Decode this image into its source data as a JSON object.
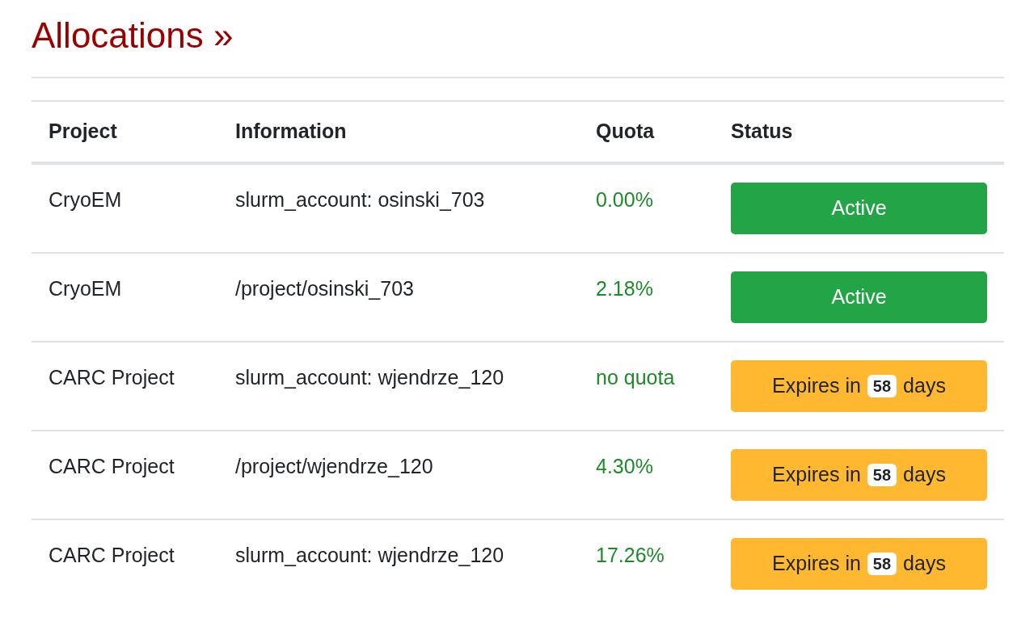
{
  "heading": "Allocations »",
  "table": {
    "columns": [
      "Project",
      "Information",
      "Quota",
      "Status"
    ],
    "rows": [
      {
        "project": "CryoEM",
        "information": "slurm_account: osinski_703",
        "quota": "0.00%",
        "status": {
          "kind": "active",
          "label": "Active"
        }
      },
      {
        "project": "CryoEM",
        "information": "/project/osinski_703",
        "quota": "2.18%",
        "status": {
          "kind": "active",
          "label": "Active"
        }
      },
      {
        "project": "CARC Project",
        "information": "slurm_account: wjendrze_120",
        "quota": "no quota",
        "status": {
          "kind": "expiring",
          "prefix": "Expires in",
          "days": "58",
          "suffix": "days"
        }
      },
      {
        "project": "CARC Project",
        "information": "/project/wjendrze_120",
        "quota": "4.30%",
        "status": {
          "kind": "expiring",
          "prefix": "Expires in",
          "days": "58",
          "suffix": "days"
        }
      },
      {
        "project": "CARC Project",
        "information": "slurm_account: wjendrze_120",
        "quota": "17.26%",
        "status": {
          "kind": "expiring",
          "prefix": "Expires in",
          "days": "58",
          "suffix": "days"
        }
      }
    ]
  }
}
